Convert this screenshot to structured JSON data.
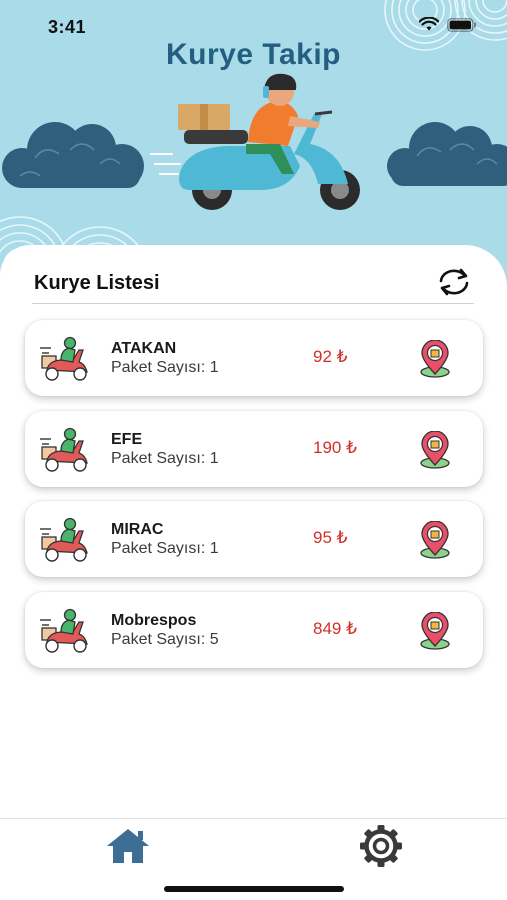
{
  "status_bar": {
    "time": "3:41"
  },
  "header": {
    "title": "Kurye Takip"
  },
  "courier_list": {
    "title": "Kurye Listesi",
    "items": [
      {
        "name": "ATAKAN",
        "packets": "Paket Sayısı: 1",
        "amount": "92 ₺"
      },
      {
        "name": "EFE",
        "packets": "Paket Sayısı: 1",
        "amount": "190 ₺"
      },
      {
        "name": "MIRAC",
        "packets": "Paket Sayısı: 1",
        "amount": "95 ₺"
      },
      {
        "name": "Mobrespos",
        "packets": "Paket Sayısı: 5",
        "amount": "849 ₺"
      }
    ]
  },
  "icons": {
    "refresh": "refresh-icon",
    "courier_avatar": "courier-scooter-icon",
    "location": "location-pin-icon",
    "home": "home-icon",
    "settings": "gear-icon"
  },
  "colors": {
    "header_background": "#a9dbe9",
    "title": "#245f80",
    "amount": "#d0302a",
    "active_tab": "#3b6e92"
  }
}
